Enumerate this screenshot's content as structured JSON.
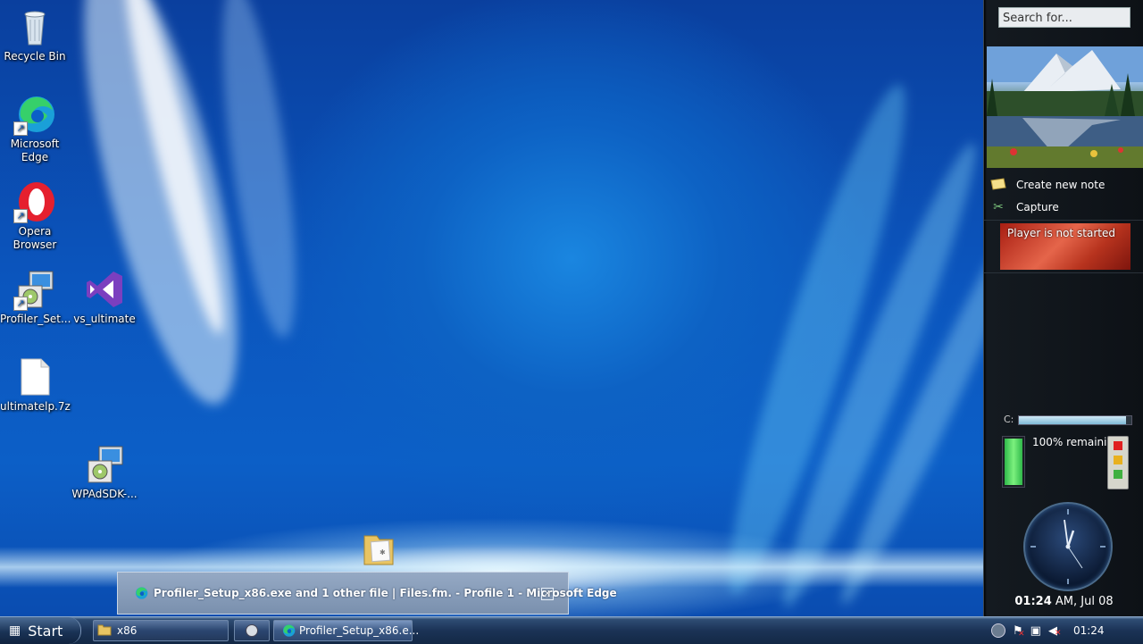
{
  "desktop": {
    "icons": [
      {
        "label": "Recycle Bin",
        "icon": "recycle-bin-icon"
      },
      {
        "label": "Microsoft Edge",
        "label_lines": [
          "Microsoft",
          "Edge"
        ],
        "icon": "edge-icon"
      },
      {
        "label": "Opera Browser",
        "label_lines": [
          "Opera",
          "Browser"
        ],
        "icon": "opera-icon"
      },
      {
        "label": "Profiler_Set...",
        "icon": "installer-icon"
      },
      {
        "label": "vs_ultimate",
        "icon": "visual-studio-icon"
      },
      {
        "label": "ultimatelp.7z",
        "icon": "file-icon"
      },
      {
        "label": "WPAdSDK-...",
        "icon": "installer-icon"
      }
    ],
    "dragging_item": "folder-icon"
  },
  "sidebar": {
    "search_placeholder": "Search for...",
    "notes": {
      "create_label": "Create new note",
      "capture_label": "Capture"
    },
    "player_status": "Player is not started",
    "drive_label": "C:",
    "drive_fill": 0.95,
    "battery_text": "100% remaining",
    "battery_fill": 1.0,
    "clock_time": "01:24",
    "clock_suffix": "AM, Jul 08"
  },
  "notification": {
    "title": "Profiler_Setup_x86.exe and 1 other file | Files.fm. - Profile 1 - Microsoft Edge",
    "close_label": "✕"
  },
  "taskbar": {
    "start_label": "Start",
    "buttons": [
      {
        "label": "x86",
        "icon": "folder-icon"
      },
      {
        "label": "",
        "icon": "app-icon"
      },
      {
        "label": "Profiler_Setup_x86.e...",
        "icon": "edge-icon"
      }
    ],
    "tray_time": "01:24"
  },
  "colors": {
    "accent": "#0b5fc7",
    "taskbar": "#1b3356",
    "sidebar": "#0d1116"
  }
}
